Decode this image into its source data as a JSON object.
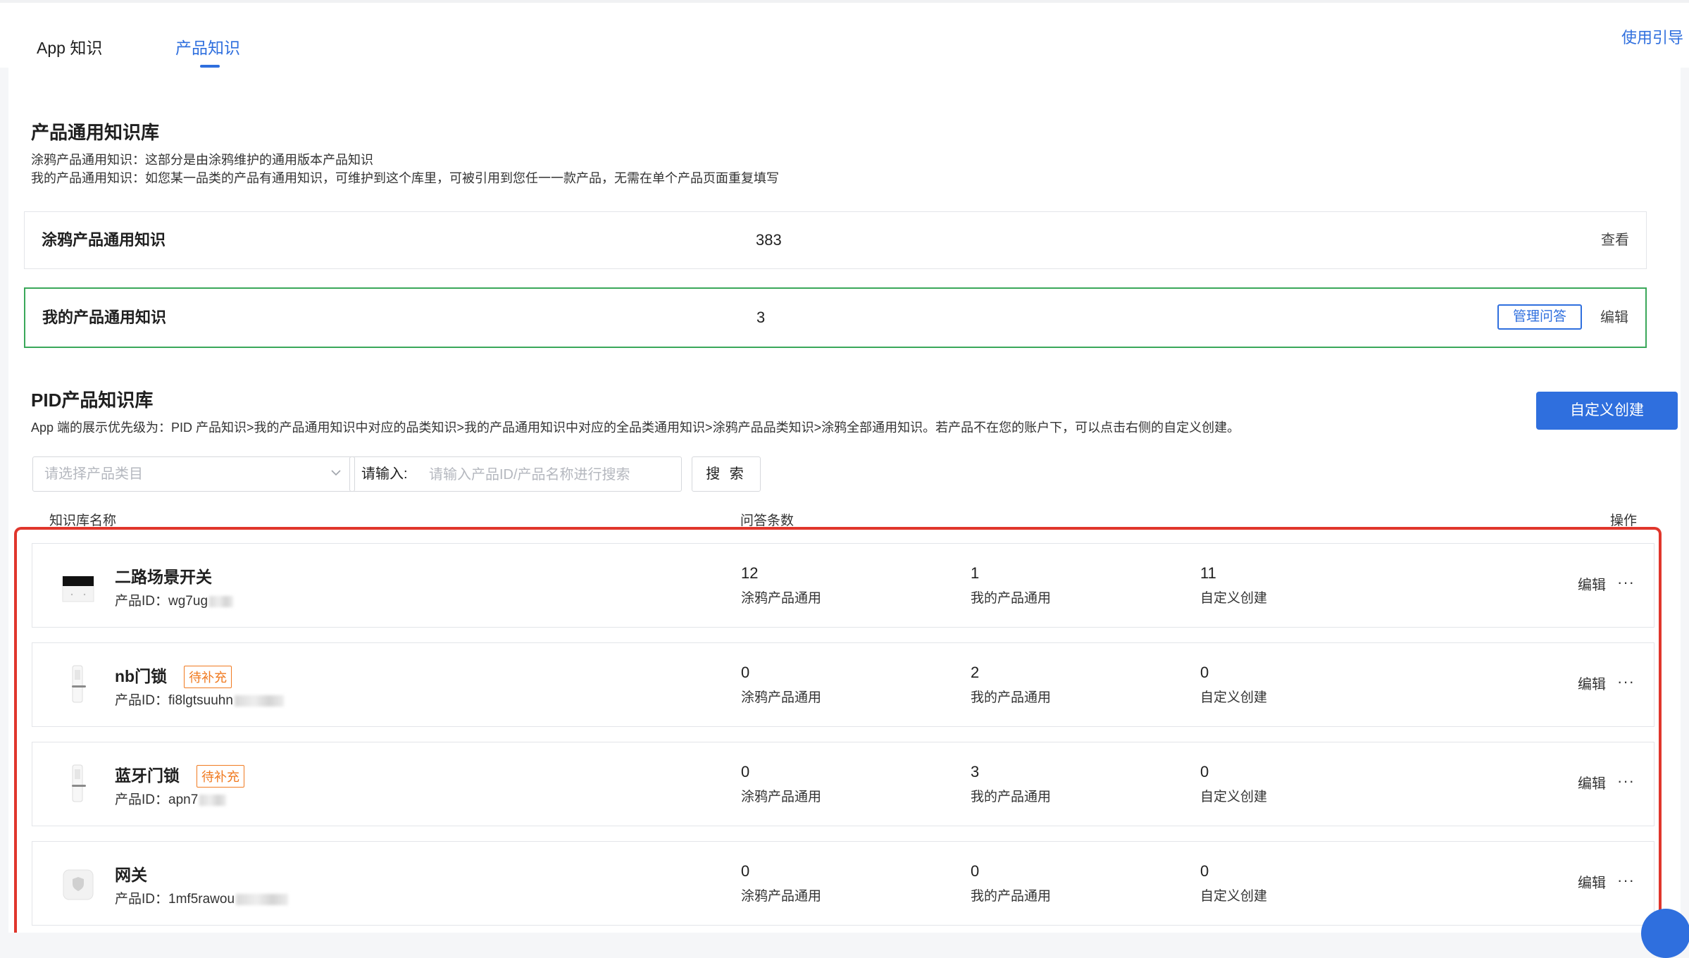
{
  "tabs": [
    {
      "label": "App 知识",
      "active": false
    },
    {
      "label": "产品知识",
      "active": true
    }
  ],
  "guide_link": "使用引导",
  "general_kb": {
    "title": "产品通用知识库",
    "desc_line1": "涂鸦产品通用知识：这部分是由涂鸦维护的通用版本产品知识",
    "desc_line2": "我的产品通用知识：如您某一品类的产品有通用知识，可维护到这个库里，可被引用到您任一一款产品，无需在单个产品页面重复填写",
    "items": [
      {
        "name": "涂鸦产品通用知识",
        "count": "383",
        "action": "查看"
      },
      {
        "name": "我的产品通用知识",
        "count": "3",
        "manage": "管理问答",
        "action": "编辑"
      }
    ]
  },
  "pid_kb": {
    "title": "PID产品知识库",
    "desc": "App 端的展示优先级为：PID 产品知识>我的产品通用知识中对应的品类知识>我的产品通用知识中对应的全品类通用知识>涂鸦产品品类知识>涂鸦全部通用知识。若产品不在您的账户下，可以点击右侧的自定义创建。",
    "create_button": "自定义创建",
    "filter": {
      "category_placeholder": "请选择产品类目",
      "input_label": "请输入:",
      "input_placeholder": "请输入产品ID/产品名称进行搜索",
      "search_button": "搜 索"
    },
    "columns": {
      "name": "知识库名称",
      "count": "问答条数",
      "ops": "操作"
    },
    "stat_labels": {
      "tuya": "涂鸦产品通用",
      "mine": "我的产品通用",
      "custom": "自定义创建"
    },
    "rows": [
      {
        "name": "二路场景开关",
        "badge": "",
        "pid_label": "产品ID：",
        "pid": "wg7ug",
        "tuya": "12",
        "mine": "1",
        "custom": "11",
        "edit": "编辑",
        "more": "···",
        "icon": "switch-thumb-icon"
      },
      {
        "name": "nb门锁",
        "badge": "待补充",
        "pid_label": "产品ID：",
        "pid": "fi8lgtsuuhn",
        "tuya": "0",
        "mine": "2",
        "custom": "0",
        "edit": "编辑",
        "more": "···",
        "icon": "door-lock-thumb-icon"
      },
      {
        "name": "蓝牙门锁",
        "badge": "待补充",
        "pid_label": "产品ID：",
        "pid": "apn7",
        "tuya": "0",
        "mine": "3",
        "custom": "0",
        "edit": "编辑",
        "more": "···",
        "icon": "door-lock-thumb-icon"
      },
      {
        "name": "网关",
        "badge": "",
        "pid_label": "产品ID：",
        "pid": "1mf5rawou",
        "tuya": "0",
        "mine": "0",
        "custom": "0",
        "edit": "编辑",
        "more": "···",
        "icon": "gateway-thumb-icon"
      }
    ]
  },
  "colors": {
    "accent": "#2f6fde",
    "active_border": "#3aa85a",
    "badge": "#f07a20",
    "highlight": "#e0362c"
  }
}
